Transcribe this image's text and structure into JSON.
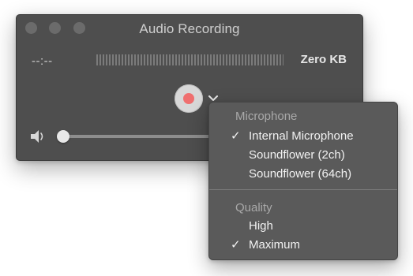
{
  "window": {
    "title": "Audio Recording",
    "time": "--:--",
    "file_size": "Zero KB"
  },
  "icons": {
    "record": "record-icon",
    "chevron": "chevron-down-icon",
    "speaker": "speaker-icon",
    "check": "checkmark-icon"
  },
  "colors": {
    "window_bg": "#4e4e4e",
    "menu_bg": "#5a5a5a",
    "record_dot": "#ef6f6f"
  },
  "menu": {
    "microphone_header": "Microphone",
    "microphone_items": [
      {
        "label": "Internal Microphone",
        "check": "✓"
      },
      {
        "label": "Soundflower (2ch)",
        "check": ""
      },
      {
        "label": "Soundflower (64ch)",
        "check": ""
      }
    ],
    "quality_header": "Quality",
    "quality_items": [
      {
        "label": "High",
        "check": ""
      },
      {
        "label": "Maximum",
        "check": "✓"
      }
    ]
  },
  "volume": {
    "level": 0
  }
}
